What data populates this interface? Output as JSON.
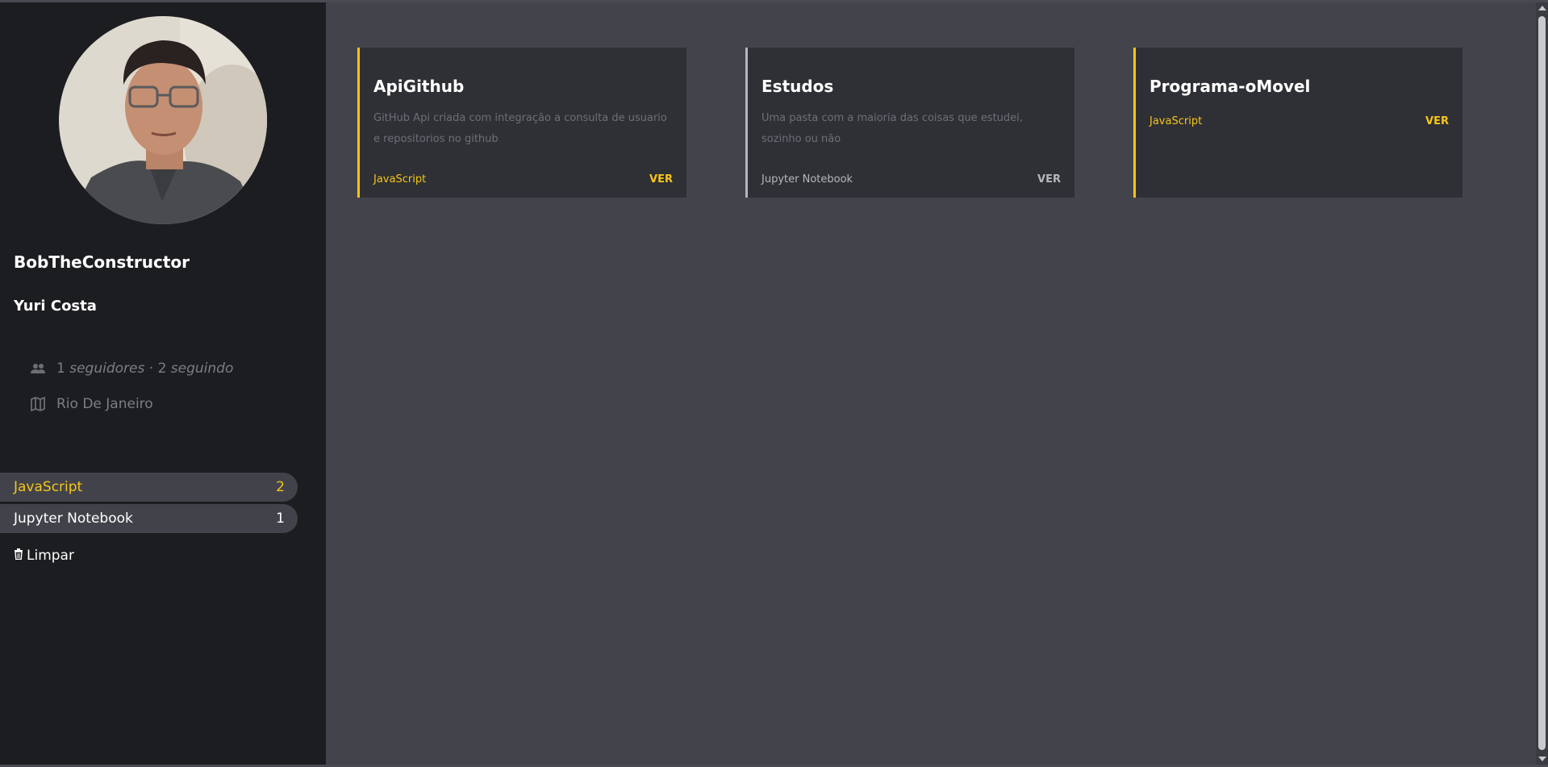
{
  "profile": {
    "username": "BobTheConstructor",
    "name": "Yuri Costa",
    "followers_count": "1",
    "followers_label": "seguidores",
    "separator": "·",
    "following_count": "2",
    "following_label": "seguindo",
    "location": "Rio De Janeiro",
    "avatar_icon": "profile-photo"
  },
  "filters": {
    "languages": [
      {
        "name": "JavaScript",
        "count": "2",
        "color": "#f5c518"
      },
      {
        "name": "Jupyter Notebook",
        "count": "1",
        "color": "#ffffff"
      }
    ],
    "clear_label": "Limpar",
    "clear_icon": "trash-icon"
  },
  "repos": [
    {
      "name": "ApiGithub",
      "description": "GitHub Api criada com integração a consulta de usuario e repositorios no github",
      "language": "JavaScript",
      "action": "VER",
      "accent": "#f5c518"
    },
    {
      "name": "Estudos",
      "description": "Uma pasta com a maioria das coisas que estudei, sozinho ou não",
      "language": "Jupyter Notebook",
      "action": "VER",
      "accent": "#b5b7bd"
    },
    {
      "name": "Programa-oMovel",
      "description": "",
      "language": "JavaScript",
      "action": "VER",
      "accent": "#f5c518"
    }
  ],
  "colors": {
    "sidebar_bg": "#1c1d21",
    "main_bg": "#43444b",
    "card_bg": "#2f3035",
    "accent": "#f5c518"
  }
}
